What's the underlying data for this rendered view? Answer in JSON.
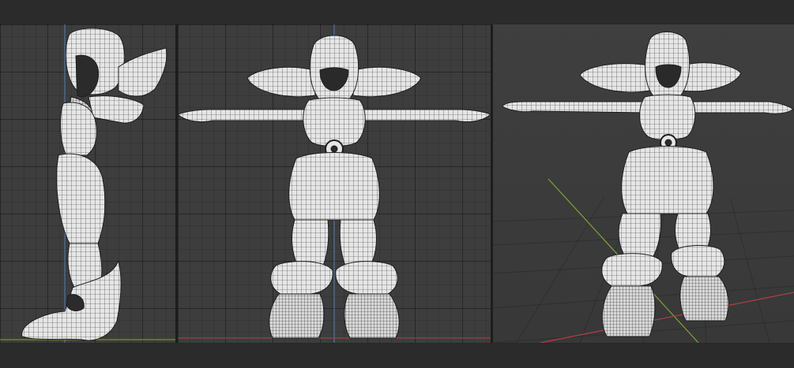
{
  "app": {
    "name": "3d-modeling-viewports"
  },
  "colors": {
    "ui_background": "#282828",
    "viewport_background": "#3d3d3d",
    "mesh_fill": "#e6e6e6",
    "wire": "#2a2a2a",
    "axis_z_blue": "#4a73b5",
    "axis_x_red": "#b33e48",
    "axis_y_green": "#7aa632"
  },
  "icons": {
    "character-mesh": "wireframe-figure"
  }
}
